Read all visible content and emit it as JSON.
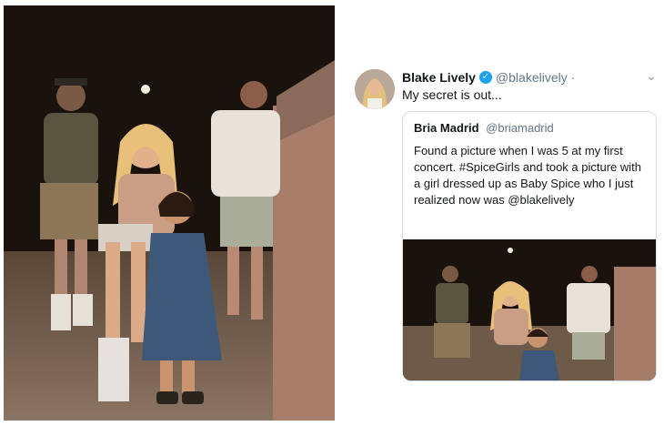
{
  "tweet": {
    "author_name": "Blake Lively",
    "author_handle": "@blakelively",
    "separator": "·",
    "verified_icon": "check",
    "menu_icon": "chevron-down-icon",
    "text": "My secret is out...",
    "quoted": {
      "author_name": "Bria Madrid",
      "author_handle": "@briamadrid",
      "text": "Found a picture when I was 5 at my first concert. #SpiceGirls and took a picture with a girl dressed up as Baby Spice who I just realized now was  @blakelively"
    }
  },
  "colors": {
    "verified": "#1da1f2",
    "handle": "#657786",
    "border": "#d5dde3"
  }
}
